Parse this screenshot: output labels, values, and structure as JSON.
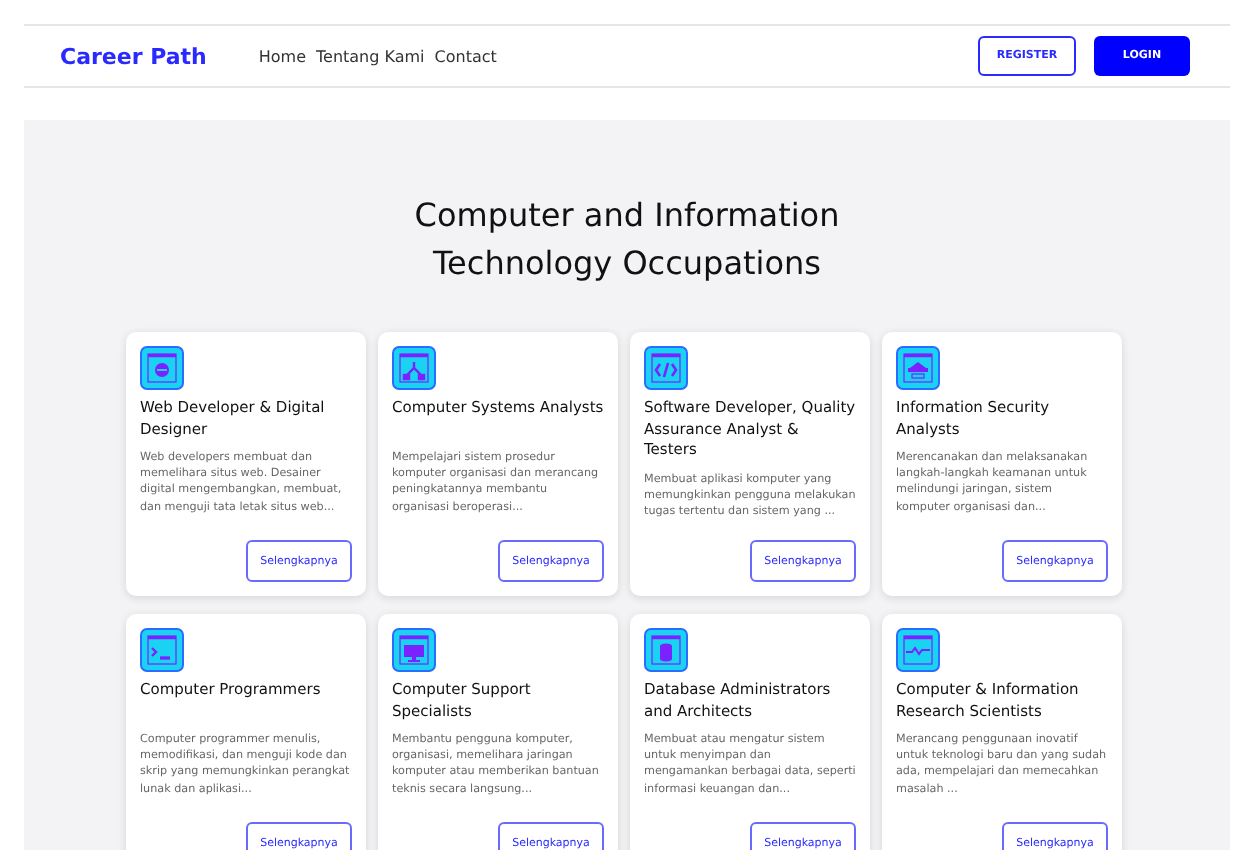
{
  "navbar": {
    "brand": "Career Path",
    "links": [
      "Home",
      "Tentang Kami",
      "Contact"
    ],
    "register_button": "REGISTER",
    "login_button": "LOGIN"
  },
  "heading": [
    "Computer and Information",
    "Technology Occupations"
  ],
  "cards": [
    {
      "title": "Web Developer & Digital Designer",
      "description": "Web developers membuat dan memelihara situs web. Desainer digital mengembangkan, membuat, dan menguji tata letak situs web...",
      "button": "Selengkapnya"
    },
    {
      "title": "Computer Systems Analysts",
      "description": "Mempelajari sistem prosedur komputer organisasi dan merancang peningkatannya membantu organisasi beroperasi...",
      "button": "Selengkapnya"
    },
    {
      "title": "Software Developer, Quality Assurance Analyst & Testers",
      "description": "Membuat aplikasi komputer yang memungkinkan pengguna melakukan tugas tertentu dan sistem yang ...",
      "button": "Selengkapnya"
    },
    {
      "title": "Information Security Analysts",
      "description": "Merencanakan dan melaksanakan langkah-langkah keamanan untuk melindungi jaringan, sistem komputer organisasi dan...",
      "button": "Selengkapnya"
    },
    {
      "title": "Computer Programmers",
      "description": "Computer programmer menulis, memodifikasi, dan menguji kode dan skrip yang memungkinkan perangkat lunak dan aplikasi...",
      "button": "Selengkapnya"
    },
    {
      "title": "Computer Support Specialists",
      "description": "Membantu pengguna komputer, organisasi, memelihara jaringan komputer atau memberikan bantuan teknis secara langsung...",
      "button": "Selengkapnya"
    },
    {
      "title": "Database Administrators and Architects",
      "description": "Membuat atau mengatur sistem untuk menyimpan dan mengamankan berbagai data, seperti informasi keuangan dan...",
      "button": "Selengkapnya"
    },
    {
      "title": "Computer & Information Research Scientists",
      "description": "Merancang penggunaan inovatif untuk teknologi baru dan yang sudah ada, mempelajari dan memecahkan masalah ...",
      "button": "Selengkapnya"
    }
  ]
}
